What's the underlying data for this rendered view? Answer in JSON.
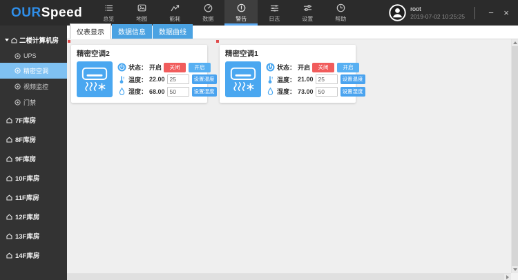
{
  "navbar": {
    "logo": {
      "part1": "OUR",
      "part2": "Speed"
    },
    "items": [
      {
        "label": "总览",
        "icon": "overview-list-icon",
        "active": false
      },
      {
        "label": "地图",
        "icon": "map-icon",
        "active": false
      },
      {
        "label": "能耗",
        "icon": "energy-chart-icon",
        "active": false
      },
      {
        "label": "数据",
        "icon": "data-gauge-icon",
        "active": false
      },
      {
        "label": "警告",
        "icon": "alert-icon",
        "active": true
      },
      {
        "label": "日志",
        "icon": "log-icon",
        "active": false
      },
      {
        "label": "设置",
        "icon": "settings-icon",
        "active": false
      },
      {
        "label": "帮助",
        "icon": "help-icon",
        "active": false
      }
    ],
    "user": {
      "name": "root",
      "datetime": "2019-07-02 10:25:25"
    },
    "window_controls": {
      "minimize": "−",
      "close": "×"
    }
  },
  "sidebar": {
    "root_node": {
      "label": "二楼计算机房"
    },
    "children": [
      {
        "label": "UPS",
        "selected": false
      },
      {
        "label": "精密空调",
        "selected": true
      },
      {
        "label": "视频监控",
        "selected": false
      },
      {
        "label": "门禁",
        "selected": false
      }
    ],
    "rooms": [
      {
        "label": "7F库房"
      },
      {
        "label": "8F库房"
      },
      {
        "label": "9F库房"
      },
      {
        "label": "10F库房"
      },
      {
        "label": "11F库房"
      },
      {
        "label": "12F库房"
      },
      {
        "label": "13F库房"
      },
      {
        "label": "14F库房"
      }
    ]
  },
  "tabs": [
    {
      "label": "仪表显示",
      "active": true
    },
    {
      "label": "数据信息",
      "active": false
    },
    {
      "label": "数据曲线",
      "active": false
    }
  ],
  "cards": [
    {
      "title": "精密空调2",
      "status_label": "状态：",
      "status_value": "开启",
      "off_button": "关闭",
      "on_button": "开启",
      "temp_label": "温度：",
      "temp_value": "22.00",
      "temp_input": "25",
      "set_temp_button": "设置温度",
      "hum_label": "湿度：",
      "hum_value": "68.00",
      "hum_input": "50",
      "set_hum_button": "设置湿度"
    },
    {
      "title": "精密空调1",
      "status_label": "状态：",
      "status_value": "开启",
      "off_button": "关闭",
      "on_button": "开启",
      "temp_label": "温度：",
      "temp_value": "21.00",
      "temp_input": "25",
      "set_temp_button": "设置温度",
      "hum_label": "湿度：",
      "hum_value": "73.00",
      "hum_input": "50",
      "set_hum_button": "设置湿度"
    }
  ],
  "colors": {
    "navbar_bg": "#2b2b2b",
    "navbar_active_bg": "#3e3e3e",
    "accent_blue": "#4aa3ef",
    "accent_underline": "#5caaf2",
    "logo_blue": "#2f8ee8",
    "sidebar_bg": "#333333",
    "sidebar_selected": "#7fc1f2",
    "tab_inactive": "#4aa2e2",
    "content_bg": "#efefef",
    "btn_red": "#f15c5c",
    "btn_blue": "#58b0f2",
    "ac_tile_blue": "#4aa7f0"
  }
}
